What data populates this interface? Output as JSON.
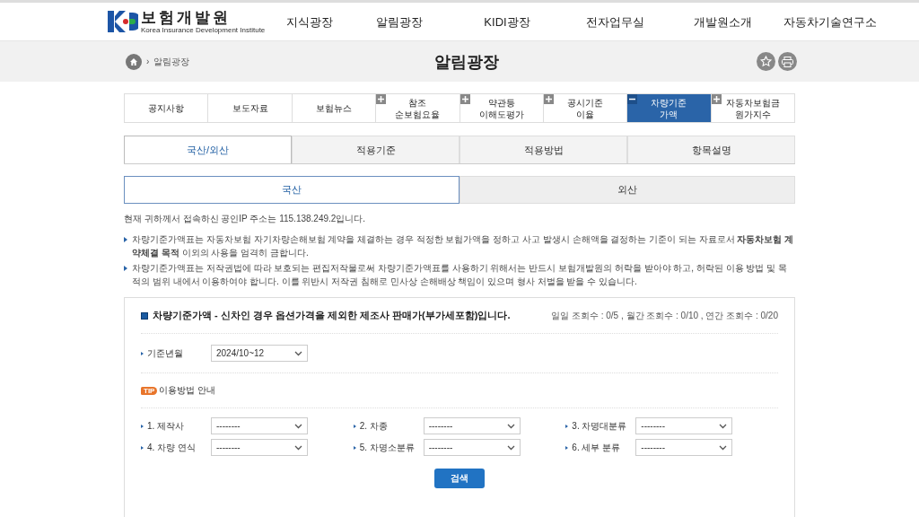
{
  "header": {
    "logo_title": "보험개발원",
    "logo_subtitle": "Korea Insurance Development Institute",
    "nav": [
      "지식광장",
      "알림광장",
      "KIDI광장",
      "전자업무실",
      "개발원소개",
      "자동차기술연구소"
    ]
  },
  "title_bar": {
    "home_separator": "›",
    "breadcrumb": "알림광장",
    "title": "알림광장"
  },
  "menu": [
    {
      "label": "공지사항",
      "kind": "plain",
      "selected": false
    },
    {
      "label": "보도자료",
      "kind": "plain",
      "selected": false
    },
    {
      "label": "보험뉴스",
      "kind": "plain",
      "selected": false
    },
    {
      "label": "참조\n순보험요율",
      "kind": "collapsed",
      "selected": false
    },
    {
      "label": "약관등\n이해도평가",
      "kind": "collapsed",
      "selected": false
    },
    {
      "label": "공시기준\n이율",
      "kind": "collapsed",
      "selected": false
    },
    {
      "label": "차량기준\n가액",
      "kind": "expanded",
      "selected": true
    },
    {
      "label": "자동차보험금\n원가지수",
      "kind": "collapsed",
      "selected": false
    }
  ],
  "tabs": [
    {
      "label": "국산/외산",
      "selected": true
    },
    {
      "label": "적용기준",
      "selected": false
    },
    {
      "label": "적용방법",
      "selected": false
    },
    {
      "label": "항목설명",
      "selected": false
    }
  ],
  "segments": [
    {
      "label": "국산",
      "selected": true
    },
    {
      "label": "외산",
      "selected": false
    }
  ],
  "ip_notice": "현재 귀하께서 접속하신 공인IP 주소는 115.138.249.2입니다.",
  "notices": [
    "차량기준가액표는 자동차보험 자기차량손해보험 계약을 체결하는 경우 적정한 보험가액을 정하고 사고 발생시 손해액을 결정하는 기준이 되는 자료로서 **자동차보험 계약체결 목적** 이외의 사용을 엄격히 금합니다.",
    "차량기준가액표는 저작권법에 따라 보호되는 편집저작물로써 차량기준가액표를 사용하기 위해서는 반드시 보험개발원의 허락을 받아야 하고, 허락된 이용 방법 및 목적의 범위 내에서 이용하여야 합니다. 이를 위반시 저작권 침해로 민사상 손해배상 책임이 있으며 형사 처벌을 받을 수 있습니다."
  ],
  "panel": {
    "title": "차량기준가액 - 신차인 경우 옵션가격을 제외한 제조사 판매가(부가세포함)입니다.",
    "counts": "일일 조회수 : 0/5 , 월간 조회수 : 0/10 , 연간 조회수 : 0/20",
    "period": {
      "label": "기준년월",
      "value": "2024/10~12"
    },
    "tip": {
      "badge": "TIP",
      "text": "이용방법 안내"
    },
    "filters": [
      {
        "label": "1. 제작사",
        "value": "--------"
      },
      {
        "label": "2. 차종",
        "value": "--------"
      },
      {
        "label": "3. 차명대분류",
        "value": "--------"
      },
      {
        "label": "4. 차량 연식",
        "value": "--------"
      },
      {
        "label": "5. 차명소분류",
        "value": "--------"
      },
      {
        "label": "6. 세부 분류",
        "value": "--------"
      }
    ],
    "search_button": "검색"
  }
}
